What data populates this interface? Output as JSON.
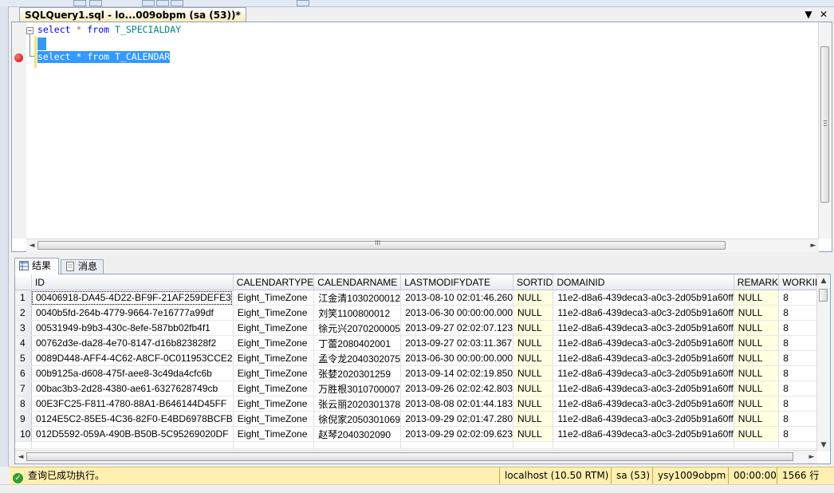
{
  "document_tab": {
    "title": "SQLQuery1.sql - lo...009obpm (sa (53))*",
    "dropdown_glyph": "▼",
    "close_glyph": "✕"
  },
  "editor": {
    "fold_glyph": "−",
    "lines": [
      {
        "keyword": "select",
        "op": "*",
        "from": "from",
        "table": "T_SPECIALDAY"
      },
      {
        "keyword": "select",
        "op": "*",
        "from": "from",
        "table": "T_CALENDAR"
      }
    ],
    "scroll_left": "◄",
    "scroll_right": "►",
    "scroll_grip": "III"
  },
  "results_tabs": {
    "results_label": "结果",
    "messages_label": "消息"
  },
  "grid": {
    "columns": [
      "ID",
      "CALENDARTYPE",
      "CALENDARNAME",
      "LASTMODIFYDATE",
      "SORTID",
      "DOMAINID",
      "REMARK",
      "WORKING"
    ],
    "rows": [
      {
        "n": "1",
        "cells": [
          "00406918-DA45-4D22-BF9F-21AF259DEFE3",
          "Eight_TimeZone",
          "江金清1030200012",
          "2013-08-10 02:01:46.260",
          "NULL",
          "11e2-d8a6-439deca3-a0c3-2d05b91a60ff",
          "NULL",
          "8"
        ]
      },
      {
        "n": "2",
        "cells": [
          "0040b5fd-264b-4779-9664-7e16777a99df",
          "Eight_TimeZone",
          "刘笑1100800012",
          "2013-06-30 00:00:00.000",
          "NULL",
          "11e2-d8a6-439deca3-a0c3-2d05b91a60ff",
          "NULL",
          "8"
        ]
      },
      {
        "n": "3",
        "cells": [
          "00531949-b9b3-430c-8efe-587bb02fb4f1",
          "Eight_TimeZone",
          "徐元兴2070200005",
          "2013-09-27 02:02:07.123",
          "NULL",
          "11e2-d8a6-439deca3-a0c3-2d05b91a60ff",
          "NULL",
          "8"
        ]
      },
      {
        "n": "4",
        "cells": [
          "00762d3e-da28-4e70-8147-d16b823828f2",
          "Eight_TimeZone",
          "丁蕾2080402001",
          "2013-09-27 02:03:11.367",
          "NULL",
          "11e2-d8a6-439deca3-a0c3-2d05b91a60ff",
          "NULL",
          "8"
        ]
      },
      {
        "n": "5",
        "cells": [
          "0089D448-AFF4-4C62-A8CF-0C011953CCE2",
          "Eight_TimeZone",
          "孟令龙2040302075",
          "2013-06-30 00:00:00.000",
          "NULL",
          "11e2-d8a6-439deca3-a0c3-2d05b91a60ff",
          "NULL",
          "8"
        ]
      },
      {
        "n": "6",
        "cells": [
          "00b9125a-d608-475f-aee8-3c49da4cfc6b",
          "Eight_TimeZone",
          "张婪2020301259",
          "2013-09-14 02:02:19.850",
          "NULL",
          "11e2-d8a6-439deca3-a0c3-2d05b91a60ff",
          "NULL",
          "8"
        ]
      },
      {
        "n": "7",
        "cells": [
          "00bac3b3-2d28-4380-ae61-6327628749cb",
          "Eight_TimeZone",
          "万胜根3010700007",
          "2013-09-26 02:02:42.803",
          "NULL",
          "11e2-d8a6-439deca3-a0c3-2d05b91a60ff",
          "NULL",
          "8"
        ]
      },
      {
        "n": "8",
        "cells": [
          "00E3FC25-F811-4780-88A1-B646144D45FF",
          "Eight_TimeZone",
          "张云丽2020301378",
          "2013-08-08 02:01:44.183",
          "NULL",
          "11e2-d8a6-439deca3-a0c3-2d05b91a60ff",
          "NULL",
          "8"
        ]
      },
      {
        "n": "9",
        "cells": [
          "0124E5C2-85E5-4C36-82F0-E4BD6978BCFB",
          "Eight_TimeZone",
          "徐倪家2050301069",
          "2013-09-29 02:01:47.280",
          "NULL",
          "11e2-d8a6-439deca3-a0c3-2d05b91a60ff",
          "NULL",
          "8"
        ]
      },
      {
        "n": "10",
        "cells": [
          "012D5592-059A-490B-B50B-5C95269020DF",
          "Eight_TimeZone",
          "赵琴2040302090",
          "2013-09-29 02:02:09.623",
          "NULL",
          "11e2-d8a6-439deca3-a0c3-2d05b91a60ff",
          "NULL",
          "8"
        ]
      }
    ],
    "scroll_up": "▲",
    "scroll_down": "▼",
    "scroll_left": "◄",
    "scroll_right": "►"
  },
  "status_bar": {
    "ok_glyph": "✓",
    "message": "查询已成功执行。",
    "server": "localhost (10.50 RTM)",
    "user": "sa (53)",
    "database": "ysy1009obpm",
    "elapsed": "00:00:00",
    "row_count": "1566 行"
  },
  "colors": {
    "status_bg": "#fff0b0",
    "selection": "#3399ff",
    "null_cell_bg": "#ffffe1",
    "keyword": "#0000ff",
    "table_name": "#008080"
  }
}
